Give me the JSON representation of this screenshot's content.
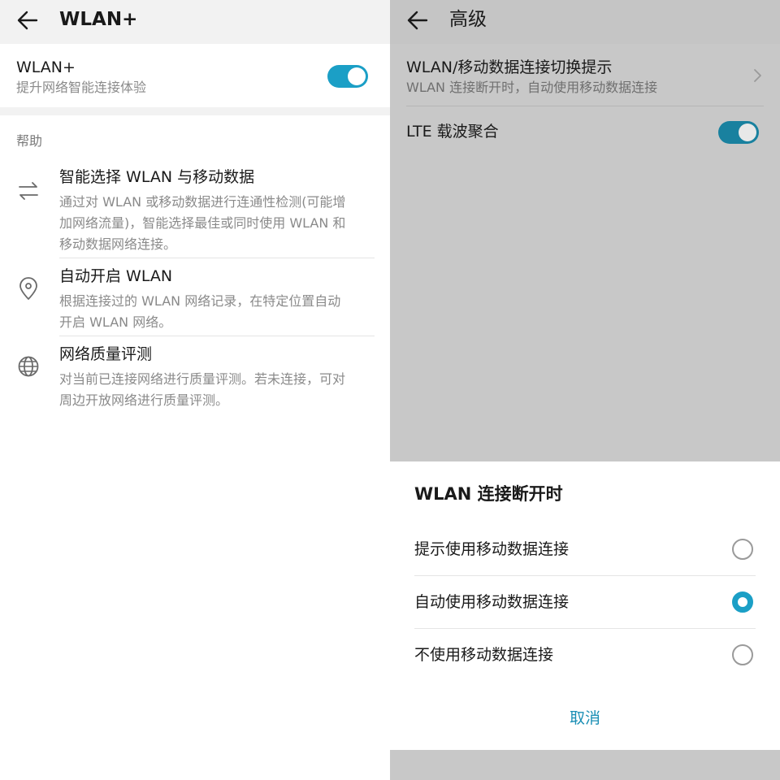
{
  "left": {
    "header": {
      "title": "WLAN+"
    },
    "main_toggle": {
      "title": "WLAN+",
      "subtitle": "提升网络智能连接体验",
      "enabled": true
    },
    "help_label": "帮助",
    "help_items": [
      {
        "icon": "swap-arrows-icon",
        "title": "智能选择 WLAN 与移动数据",
        "desc_lines": [
          "通过对 WLAN 或移动数据进行连通性检测(可能增",
          "加网络流量)，智能选择最佳或同时使用 WLAN 和",
          "移动数据网络连接。"
        ]
      },
      {
        "icon": "location-pin-icon",
        "title": "自动开启 WLAN",
        "desc_lines": [
          "根据连接过的 WLAN 网络记录，在特定位置自动",
          "开启 WLAN 网络。"
        ]
      },
      {
        "icon": "globe-icon",
        "title": "网络质量评测",
        "desc_lines": [
          "对当前已连接网络进行质量评测。若未连接，可对",
          "周边开放网络进行质量评测。"
        ]
      }
    ]
  },
  "right": {
    "header": {
      "title": "高级"
    },
    "rows": {
      "switch_prompt": {
        "title": "WLAN/移动数据连接切换提示",
        "subtitle": "WLAN 连接断开时，自动使用移动数据连接"
      },
      "lte": {
        "title": "LTE 载波聚合",
        "enabled": true
      }
    },
    "dialog": {
      "title": "WLAN 连接断开时",
      "options": [
        {
          "label": "提示使用移动数据连接",
          "checked": false
        },
        {
          "label": "自动使用移动数据连接",
          "checked": true
        },
        {
          "label": "不使用移动数据连接",
          "checked": false
        }
      ],
      "cancel_label": "取消"
    }
  },
  "colors": {
    "accent": "#1b9fc6",
    "cancel_text": "#1b8fb5",
    "dim_overlay": "#c8c8c8"
  }
}
